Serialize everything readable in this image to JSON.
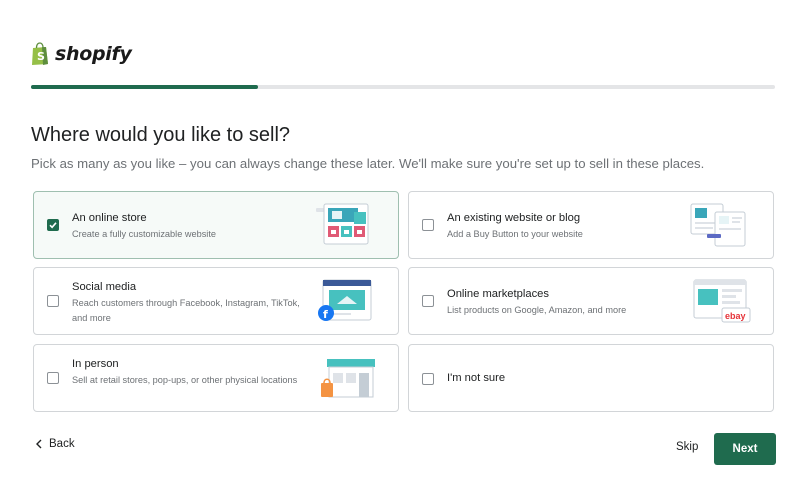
{
  "brand": {
    "name": "shopify"
  },
  "progress": {
    "fraction": 0.305
  },
  "heading": "Where would you like to sell?",
  "subheading": "Pick as many as you like – you can always change these later. We'll make sure you're set up to sell in these places.",
  "options": [
    {
      "title": "An online store",
      "description": "Create a fully customizable website",
      "checked": true
    },
    {
      "title": "An existing website or blog",
      "description": "Add a Buy Button to your website",
      "checked": false
    },
    {
      "title": "Social media",
      "description": "Reach customers through Facebook, Instagram, TikTok, and more",
      "checked": false
    },
    {
      "title": "Online marketplaces",
      "description": "List products on Google, Amazon, and more",
      "checked": false
    },
    {
      "title": "In person",
      "description": "Sell at retail stores, pop-ups, or other physical locations",
      "checked": false
    },
    {
      "title": "I'm not sure",
      "description": "",
      "checked": false
    }
  ],
  "illustration_labels": {
    "ebay": "ebay"
  },
  "footer": {
    "back_label": "Back",
    "skip_label": "Skip",
    "next_label": "Next"
  },
  "colors": {
    "accent": "#1f6b4e",
    "progress_track": "#e4e5e7",
    "card_border": "#d2d5d8"
  }
}
